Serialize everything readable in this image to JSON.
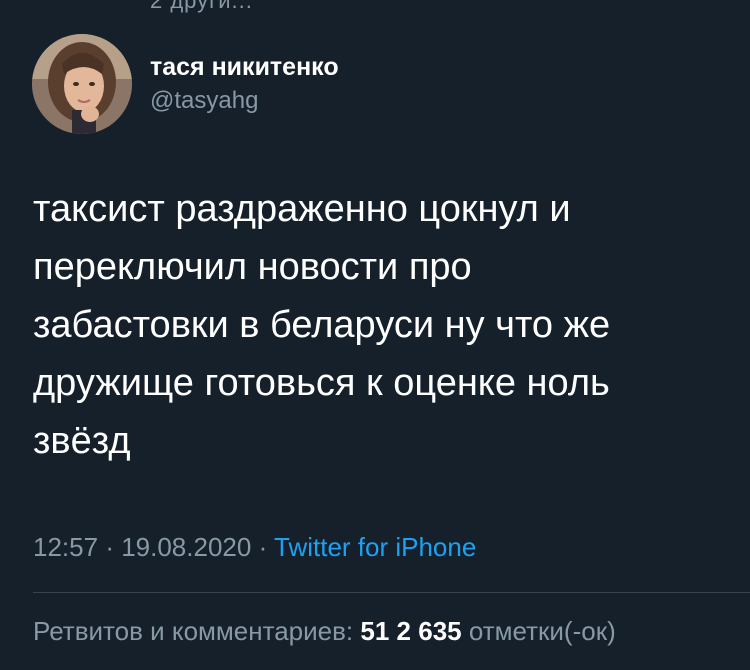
{
  "top_fragment": "2 други...",
  "user": {
    "display_name": "тася никитенко",
    "handle": "@tasyahg"
  },
  "tweet": {
    "lines": [
      "таксист раздраженно цокнул и",
      "переключил новости про",
      "забастовки в беларуси ну что же",
      "дружище готовься к оценке ноль",
      "звёзд"
    ],
    "time": "12:57",
    "date": "19.08.2020",
    "source": "Twitter for iPhone"
  },
  "stats": {
    "retweets_label": "Ретвитов и комментариев:",
    "retweets_count": "51",
    "likes_count": "2 635",
    "likes_label": "отметки(-ок)"
  },
  "colors": {
    "background": "#15202b",
    "text": "#ffffff",
    "secondary": "#8899a6",
    "link": "#1da1f2",
    "divider": "#38444d"
  },
  "icons": {
    "avatar": "profile-photo"
  }
}
